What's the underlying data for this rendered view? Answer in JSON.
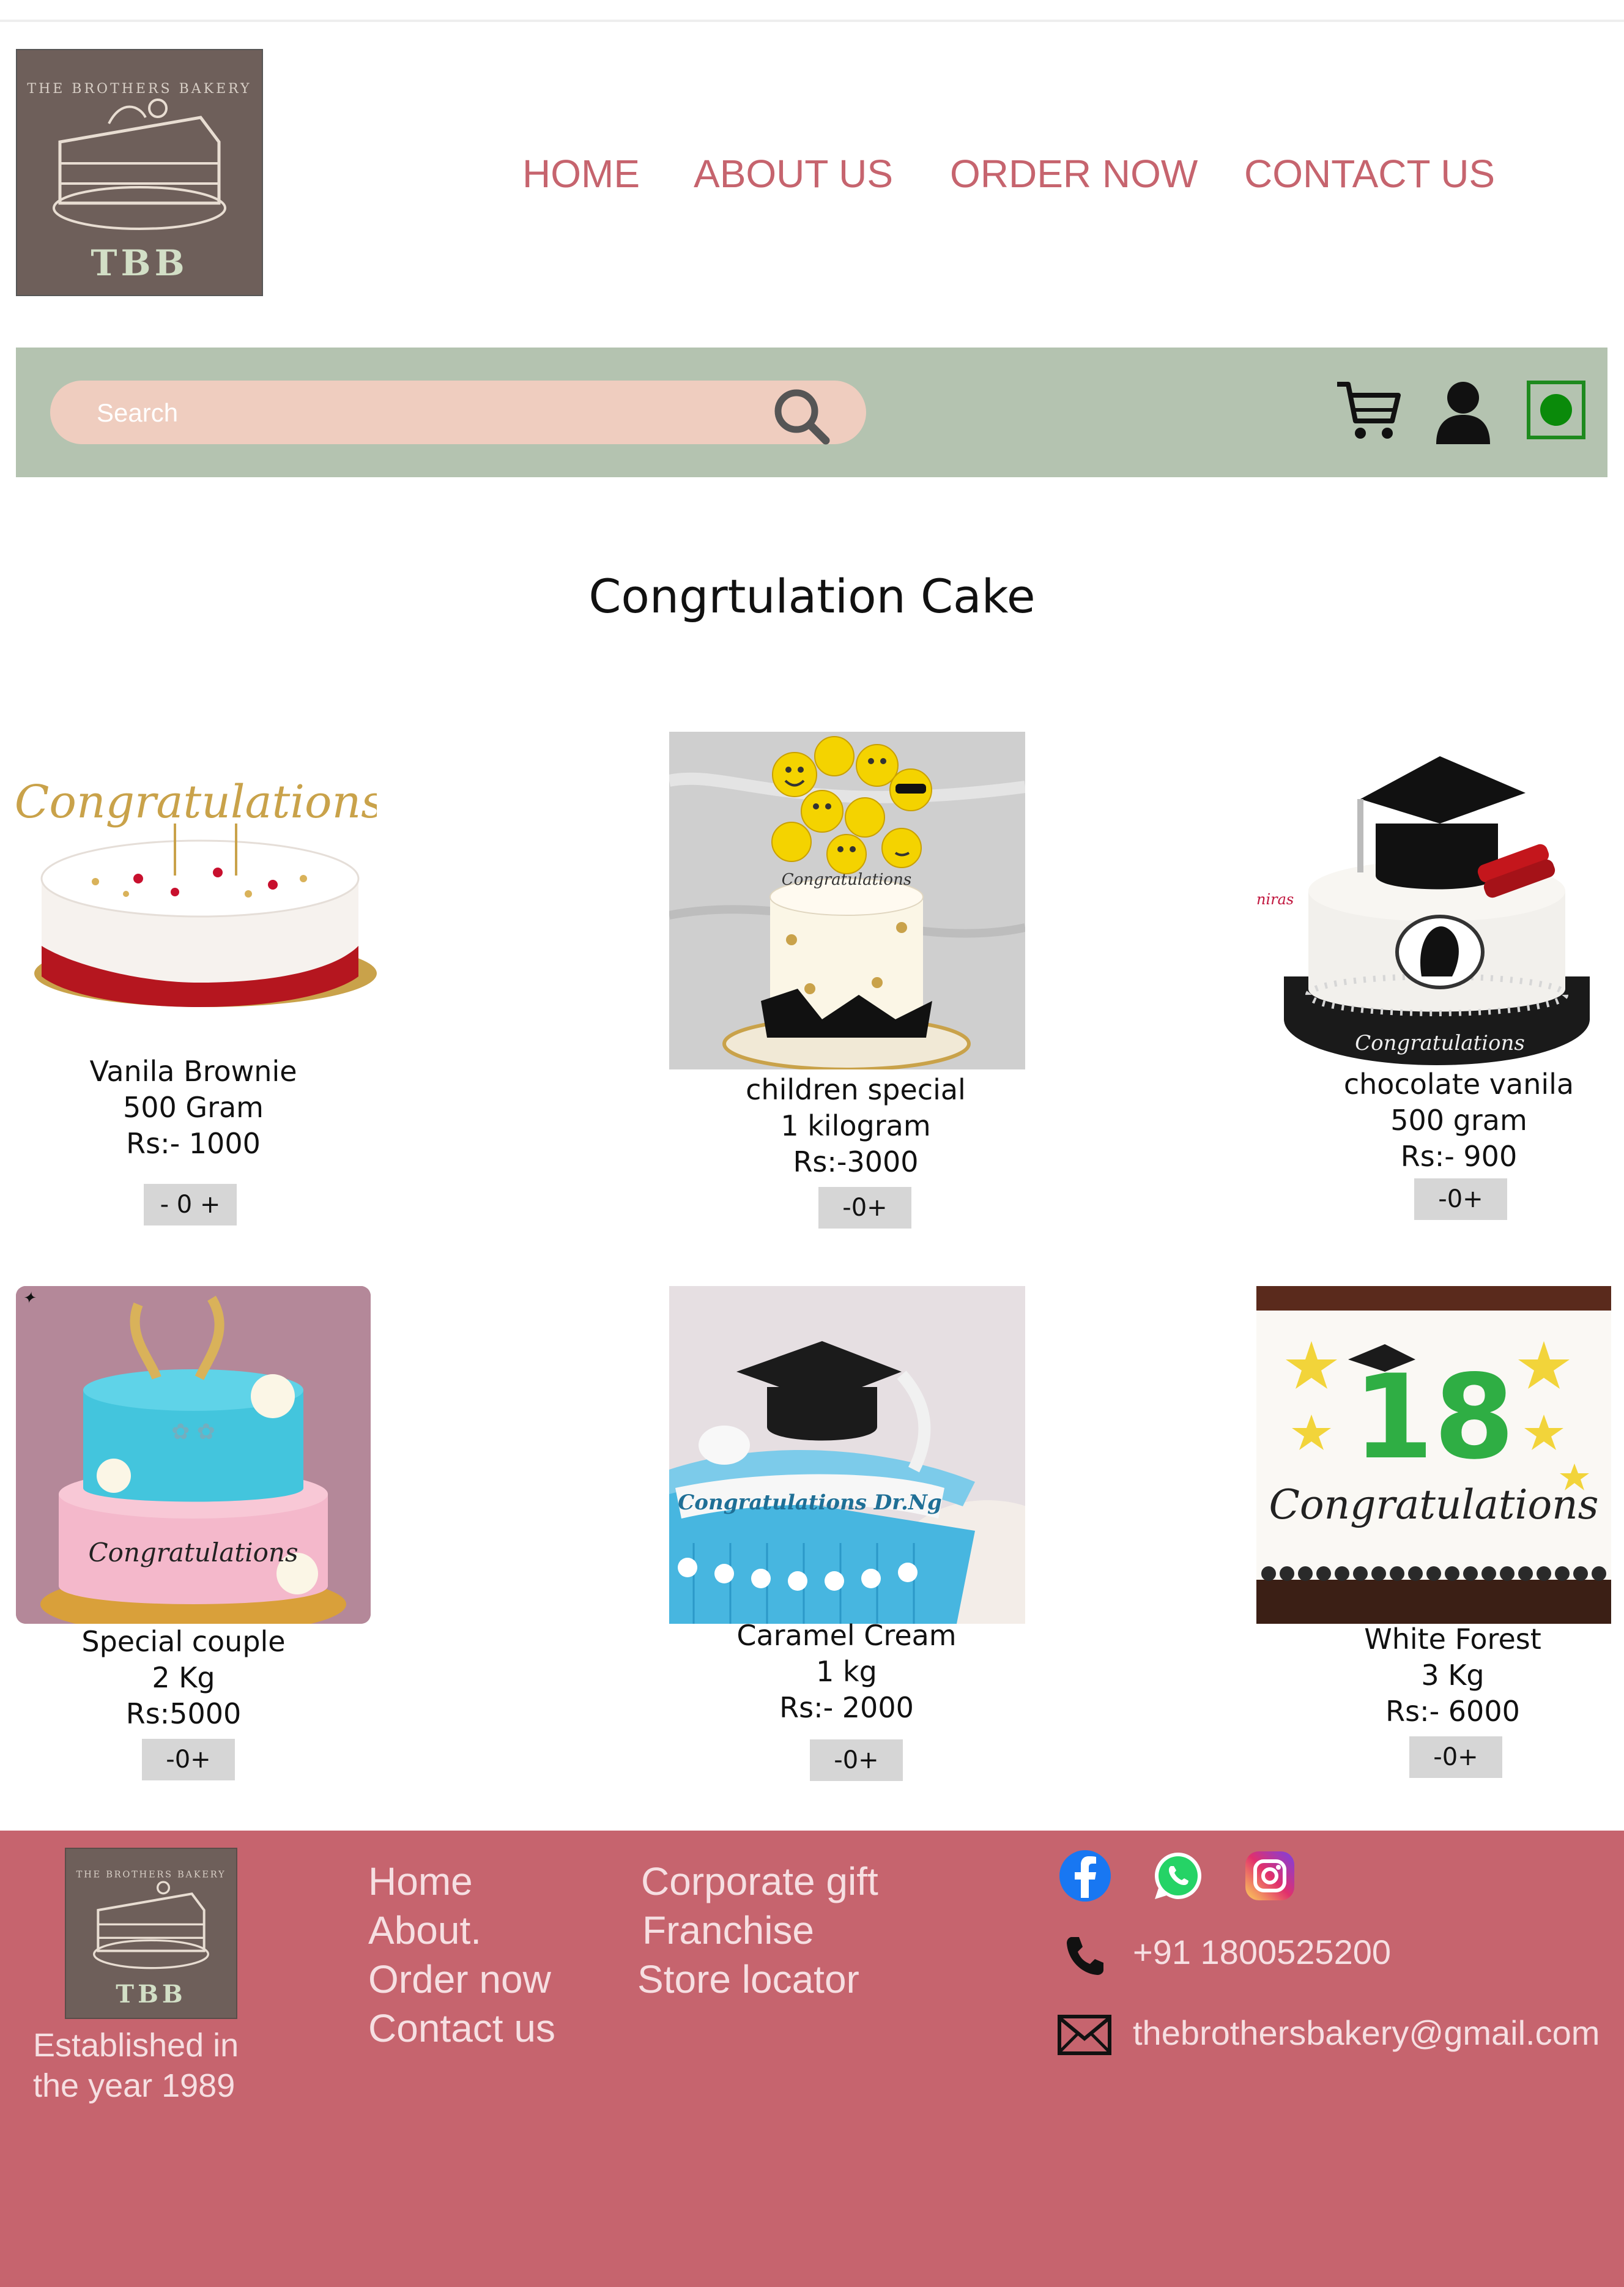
{
  "header": {
    "logo_text": "TBB",
    "logo_arc_text": "THE BROTHERS BAKERY",
    "nav": [
      "HOME",
      "ABOUT US",
      "ORDER NOW",
      "CONTACT US"
    ]
  },
  "search": {
    "placeholder": "Search"
  },
  "page_title": "Congrtulation Cake",
  "products": [
    {
      "name": "Vanila Brownie",
      "weight": "500 Gram",
      "price": "Rs:- 1000",
      "qty": "- 0 +"
    },
    {
      "name": "children special",
      "weight": "1 kilogram",
      "price": "Rs:-3000",
      "qty": "-0+"
    },
    {
      "name": "chocolate vanila",
      "weight": "500 gram",
      "price": "Rs:- 900",
      "qty": "-0+"
    },
    {
      "name": "Special couple",
      "weight": "2 Kg",
      "price": "Rs:5000",
      "qty": "-0+"
    },
    {
      "name": "Caramel Cream",
      "weight": "1 kg",
      "price": "Rs:- 2000",
      "qty": "-0+"
    },
    {
      "name": "White Forest",
      "weight": "3 Kg",
      "price": "Rs:- 6000",
      "qty": "-0+"
    }
  ],
  "cake_inscriptions": [
    "Congratulations",
    "Congratulations",
    "Congratulations",
    "Congratulations",
    "Congratulations Dr.Ng",
    "18",
    "Congratulations"
  ],
  "footer": {
    "logo_text": "TBB",
    "established": "Established in the year 1989",
    "links_col1": [
      "Home",
      "About.",
      "Order now",
      "Contact us"
    ],
    "links_col2": [
      "Corporate gift",
      "Franchise",
      "Store locator"
    ],
    "phone": "+91 1800525200",
    "email": "thebrothersbakery@gmail.com"
  },
  "colors": {
    "brand_pink": "#c6646e",
    "search_bar_green": "#b4c3b0",
    "search_field_peach": "#efcdbf",
    "logo_brown": "#6e5f5a",
    "veg_green": "#0a8a0a"
  }
}
